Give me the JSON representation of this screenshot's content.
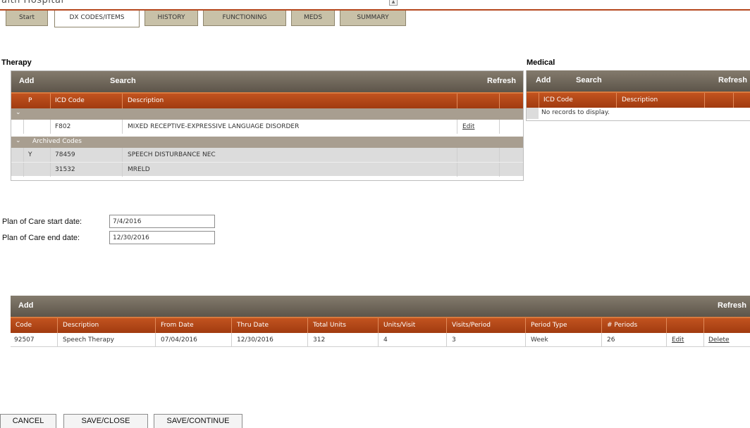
{
  "app": {
    "partial_title": "alth Hospital"
  },
  "tabs": [
    {
      "label": "Start"
    },
    {
      "label": "DX CODES/ITEMS"
    },
    {
      "label": "HISTORY"
    },
    {
      "label": "FUNCTIONING"
    },
    {
      "label": "MEDS"
    },
    {
      "label": "SUMMARY"
    }
  ],
  "therapy": {
    "title": "Therapy",
    "toolbar": {
      "add": "Add",
      "search": "Search",
      "refresh": "Refresh"
    },
    "columns": {
      "p": "P",
      "icd": "ICD Code",
      "desc": "Description"
    },
    "active_rows": [
      {
        "p": "",
        "icd": "F802",
        "desc": "MIXED RECEPTIVE-EXPRESSIVE LANGUAGE DISORDER",
        "action": "Edit"
      }
    ],
    "archived_group": "Archived Codes",
    "archived_rows": [
      {
        "p": "Y",
        "icd": "78459",
        "desc": "SPEECH DISTURBANCE NEC"
      },
      {
        "p": "",
        "icd": "31532",
        "desc": "MRELD"
      }
    ]
  },
  "medical": {
    "title": "Medical",
    "toolbar": {
      "add": "Add",
      "search": "Search",
      "refresh": "Refresh"
    },
    "columns": {
      "icd": "ICD Code",
      "desc": "Description"
    },
    "empty_text": "No records to display."
  },
  "plan_of_care": {
    "start_label": "Plan of Care start date:",
    "start_value": "7/4/2016",
    "end_label": "Plan of Care end date:",
    "end_value": "12/30/2016"
  },
  "services": {
    "toolbar": {
      "add": "Add",
      "refresh": "Refresh"
    },
    "columns": {
      "code": "Code",
      "desc": "Description",
      "from": "From Date",
      "thru": "Thru Date",
      "total": "Total Units",
      "units_visit": "Units/Visit",
      "visits_period": "Visits/Period",
      "period_type": "Period Type",
      "periods": "# Periods"
    },
    "rows": [
      {
        "code": "92507",
        "desc": "Speech Therapy",
        "from": "07/04/2016",
        "thru": "12/30/2016",
        "total": "312",
        "units_visit": "4",
        "visits_period": "3",
        "period_type": "Week",
        "periods": "26",
        "edit": "Edit",
        "delete": "Delete"
      }
    ]
  },
  "footer": {
    "cancel": "CANCEL",
    "save_close": "SAVE/CLOSE",
    "save_continue": "SAVE/CONTINUE"
  },
  "colors": {
    "header_dark": "#5d554a",
    "header_orange": "#b5471e",
    "group_gray": "#a89e90",
    "tab_tan": "#c8c1a8"
  }
}
